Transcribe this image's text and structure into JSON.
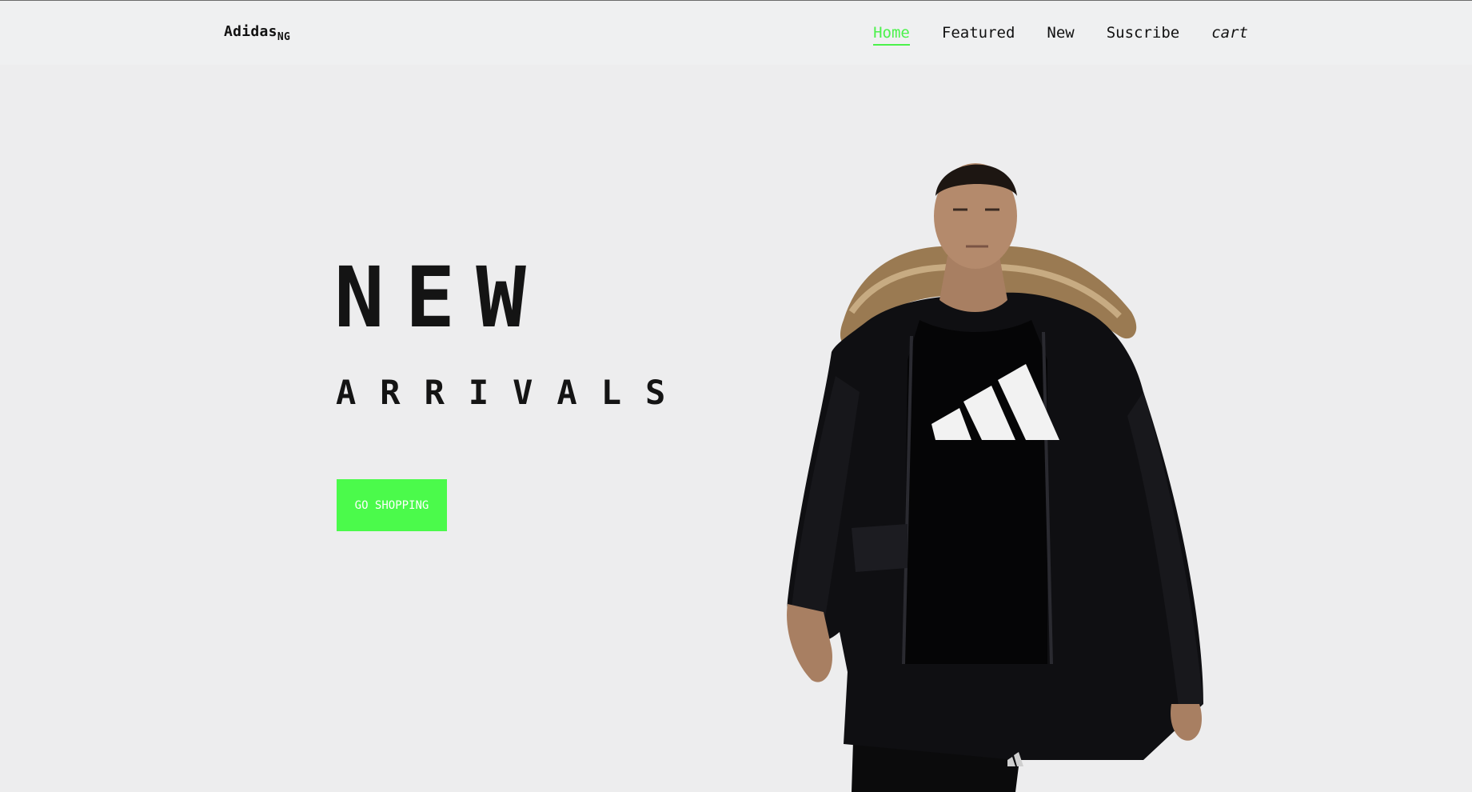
{
  "brand": {
    "name": "Adidas",
    "suffix": "NG"
  },
  "nav": {
    "items": [
      {
        "label": "Home",
        "active": true
      },
      {
        "label": "Featured",
        "active": false
      },
      {
        "label": "New",
        "active": false
      },
      {
        "label": "Suscribe",
        "active": false
      },
      {
        "label": "cart",
        "active": false
      }
    ]
  },
  "hero": {
    "title": "NEW",
    "subtitle": "ARRIVALS",
    "cta_label": "GO SHOPPING",
    "image_icon": "model-in-black-parka-icon"
  },
  "colors": {
    "accent": "#4bfa4b",
    "background": "#ededee",
    "header_bg": "#eff0f1",
    "text": "#111111"
  }
}
